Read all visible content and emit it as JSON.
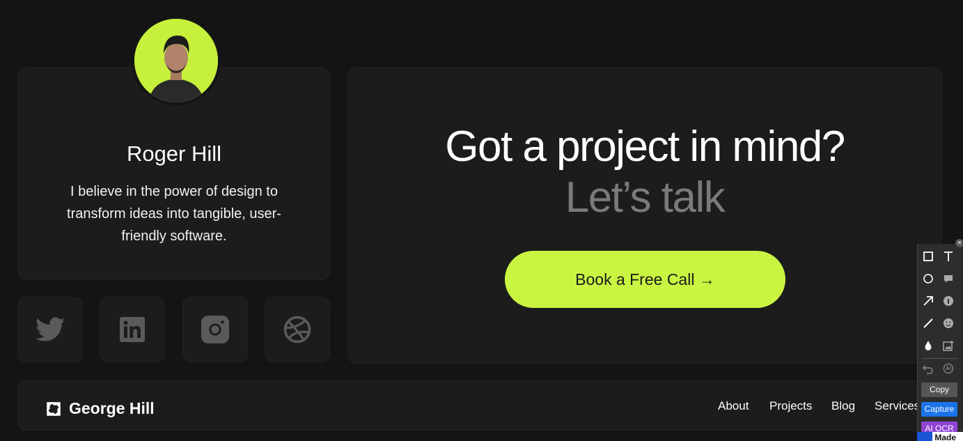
{
  "profile": {
    "name": "Roger Hill",
    "bio": "I believe in the power of design to transform ideas into tangible, user-friendly software."
  },
  "social": [
    "twitter-icon",
    "linkedin-icon",
    "instagram-icon",
    "dribbble-icon"
  ],
  "cta": {
    "title": "Got a project in mind?",
    "subtitle": "Let’s talk",
    "button_label": "Book a Free Call →",
    "accent": "#c9f542"
  },
  "footer": {
    "brand": "George Hill",
    "nav": [
      "About",
      "Projects",
      "Blog",
      "Services"
    ]
  },
  "toolbar": {
    "close": "×",
    "copy_label": "Copy",
    "capture_label": "Capture",
    "ocr_label": "AI OCR",
    "made_label": "Made"
  }
}
